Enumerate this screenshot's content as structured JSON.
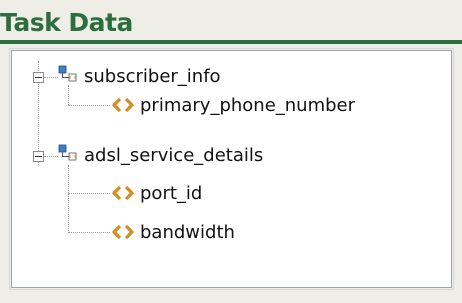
{
  "panel": {
    "title": "Task Data"
  },
  "tree": {
    "nodes": [
      {
        "label": "subscriber_info",
        "kind": "complex-type",
        "expanded": true
      },
      {
        "label": "primary_phone_number",
        "kind": "element"
      },
      {
        "label": "adsl_service_details",
        "kind": "complex-type",
        "expanded": true
      },
      {
        "label": "port_id",
        "kind": "element"
      },
      {
        "label": "bandwidth",
        "kind": "element"
      }
    ]
  },
  "colors": {
    "title": "#2b6e3f",
    "panel_background": "#efeee6",
    "tree_background": "#ffffff",
    "element_icon": "#d98c1a",
    "complex_icon": "#3d7fbf"
  }
}
